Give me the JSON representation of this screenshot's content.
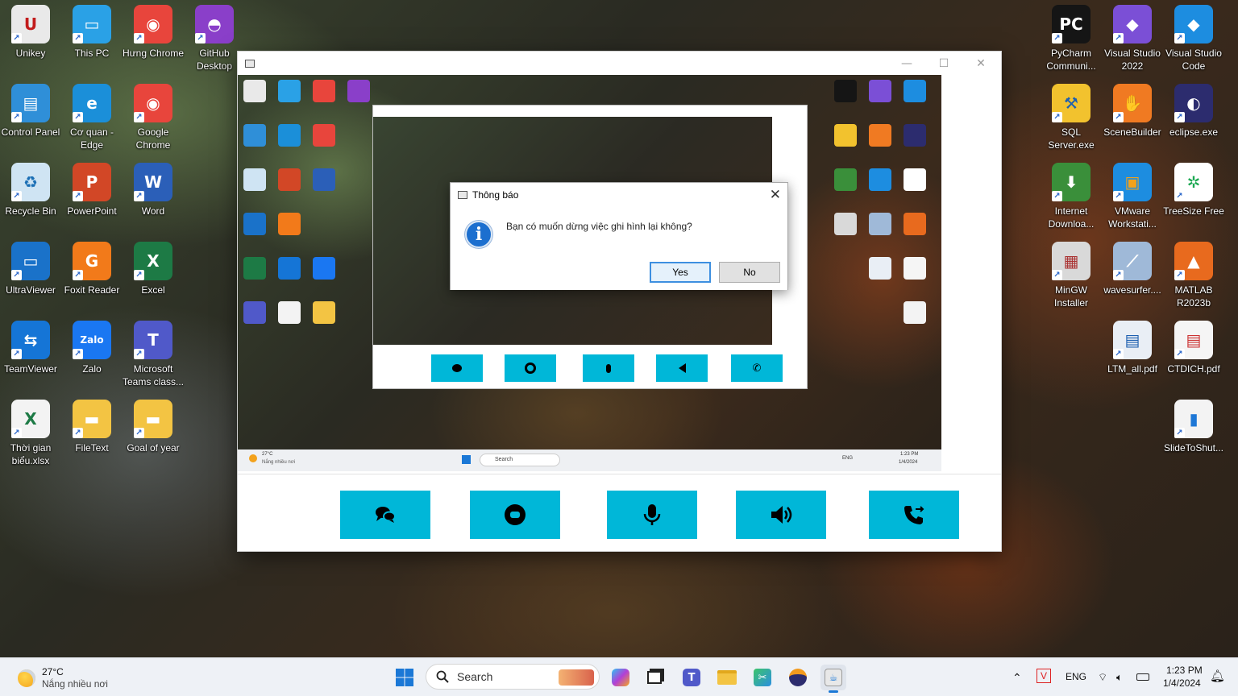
{
  "desktop": {
    "left_icons": [
      {
        "id": "unikey",
        "label": "Unikey",
        "glyph": "U",
        "color": "#e9e9e9",
        "fg": "#c21c1c"
      },
      {
        "id": "this-pc",
        "label": "This PC",
        "glyph": "▭",
        "color": "#2aa1e6",
        "fg": "#fff"
      },
      {
        "id": "hung-chrome",
        "label": "Hưng Chrome",
        "glyph": "◉",
        "color": "#e8453c",
        "fg": "#fff"
      },
      {
        "id": "github-desktop",
        "label": "GitHub Desktop",
        "glyph": "◓",
        "color": "#8a3fc9",
        "fg": "#fff"
      },
      {
        "id": "control-panel",
        "label": "Control Panel",
        "glyph": "▤",
        "color": "#2f8fd8",
        "fg": "#fff"
      },
      {
        "id": "edge",
        "label": "Cơ quan - Edge",
        "glyph": "e",
        "color": "#1b8fd9",
        "fg": "#fff"
      },
      {
        "id": "google-chrome",
        "label": "Google Chrome",
        "glyph": "◉",
        "color": "#e8453c",
        "fg": "#fff"
      },
      {
        "id": "recycle-bin",
        "label": "Recycle Bin",
        "glyph": "♻",
        "color": "#cfe4f3",
        "fg": "#1b6fb5"
      },
      {
        "id": "powerpoint",
        "label": "PowerPoint",
        "glyph": "P",
        "color": "#d24726",
        "fg": "#fff"
      },
      {
        "id": "word",
        "label": "Word",
        "glyph": "W",
        "color": "#2b5fb8",
        "fg": "#fff"
      },
      {
        "id": "ultraviewer",
        "label": "UltraViewer",
        "glyph": "▭",
        "color": "#1a72c9",
        "fg": "#fff"
      },
      {
        "id": "foxit-reader",
        "label": "Foxit Reader",
        "glyph": "G",
        "color": "#f27a1a",
        "fg": "#fff"
      },
      {
        "id": "excel",
        "label": "Excel",
        "glyph": "X",
        "color": "#1d7a45",
        "fg": "#fff"
      },
      {
        "id": "teamviewer",
        "label": "TeamViewer",
        "glyph": "⇆",
        "color": "#1575d6",
        "fg": "#fff"
      },
      {
        "id": "zalo",
        "label": "Zalo",
        "glyph": "Zalo",
        "color": "#1a77f2",
        "fg": "#fff"
      },
      {
        "id": "ms-teams",
        "label": "Microsoft Teams class...",
        "glyph": "T",
        "color": "#5059c9",
        "fg": "#fff"
      },
      {
        "id": "thoi-gian",
        "label": "Thời gian biểu.xlsx",
        "glyph": "X",
        "color": "#f3f3f3",
        "fg": "#1d7a45"
      },
      {
        "id": "filetext",
        "label": "FileText",
        "glyph": "▬",
        "color": "#f3c443",
        "fg": "#fff"
      },
      {
        "id": "goal-of-year",
        "label": "Goal of year",
        "glyph": "▬",
        "color": "#f3c443",
        "fg": "#fff"
      }
    ],
    "right_icons": [
      {
        "id": "pycharm",
        "label": "PyCharm Communi...",
        "glyph": "PC",
        "color": "#151515",
        "fg": "#fff"
      },
      {
        "id": "vs2022",
        "label": "Visual Studio 2022",
        "glyph": "◆",
        "color": "#7b4fd6",
        "fg": "#fff"
      },
      {
        "id": "vscode",
        "label": "Visual Studio Code",
        "glyph": "◆",
        "color": "#1d8de0",
        "fg": "#fff"
      },
      {
        "id": "sql-server",
        "label": "SQL Server.exe",
        "glyph": "⚒",
        "color": "#f2c22e",
        "fg": "#1d5fb0"
      },
      {
        "id": "scenebuilder",
        "label": "SceneBuilder",
        "glyph": "✋",
        "color": "#f07a22",
        "fg": "#fff"
      },
      {
        "id": "eclipse",
        "label": "eclipse.exe",
        "glyph": "◐",
        "color": "#2c2c6e",
        "fg": "#fff"
      },
      {
        "id": "idm",
        "label": "Internet Downloa...",
        "glyph": "⬇",
        "color": "#3a8f3a",
        "fg": "#fff"
      },
      {
        "id": "vmware",
        "label": "VMware Workstati...",
        "glyph": "▣",
        "color": "#1d8de0",
        "fg": "#f2a21c"
      },
      {
        "id": "treesize",
        "label": "TreeSize Free",
        "glyph": "✲",
        "color": "#fff",
        "fg": "#1aa851"
      },
      {
        "id": "mingw",
        "label": "MinGW Installer",
        "glyph": "▦",
        "color": "#d9d9d9",
        "fg": "#a33"
      },
      {
        "id": "wavesurfer",
        "label": "wavesurfer....",
        "glyph": "⟋",
        "color": "#9fb9d8",
        "fg": "#fff"
      },
      {
        "id": "matlab",
        "label": "MATLAB R2023b",
        "glyph": "▲",
        "color": "#e86a1e",
        "fg": "#fff"
      },
      {
        "id": "ltm-all",
        "label": "LTM_all.pdf",
        "glyph": "▤",
        "color": "#e9eef5",
        "fg": "#1d5fb0"
      },
      {
        "id": "ctdich",
        "label": "CTDICH.pdf",
        "glyph": "▤",
        "color": "#f5f5f5",
        "fg": "#c33"
      },
      {
        "id": "slidetoshut",
        "label": "SlideToShut...",
        "glyph": "▮",
        "color": "#f3f3f3",
        "fg": "#1d77d6"
      }
    ]
  },
  "app_window": {
    "controls": {
      "minimize": "—",
      "maximize": "☐",
      "close": "✕"
    },
    "toolbar": [
      {
        "id": "chat",
        "icon": "chat-icon"
      },
      {
        "id": "stop",
        "icon": "stop-record-icon"
      },
      {
        "id": "mic",
        "icon": "microphone-icon"
      },
      {
        "id": "speaker",
        "icon": "speaker-icon"
      },
      {
        "id": "call",
        "icon": "call-transfer-icon"
      }
    ]
  },
  "dialog": {
    "title": "Thông báo",
    "message": "Bạn có muốn dừng việc ghi hình lại không?",
    "icon": "info-icon",
    "info_glyph": "i",
    "close_glyph": "✕",
    "yes": "Yes",
    "no": "No"
  },
  "taskbar": {
    "weather_temp": "27°C",
    "weather_desc": "Nắng nhiều nơi",
    "search_placeholder": "Search",
    "language": "ENG",
    "time": "1:23 PM",
    "date": "1/4/2024",
    "apps": [
      "start",
      "search",
      "copilot",
      "task-view",
      "teams",
      "file-explorer",
      "snipping",
      "eclipse",
      "app-in-use"
    ]
  },
  "inner_screenshot": {
    "weather_temp": "27°C",
    "weather_desc": "Nắng nhiều nơi",
    "search": "Search",
    "language": "ENG",
    "time": "1:23 PM",
    "date": "1/4/2024"
  }
}
